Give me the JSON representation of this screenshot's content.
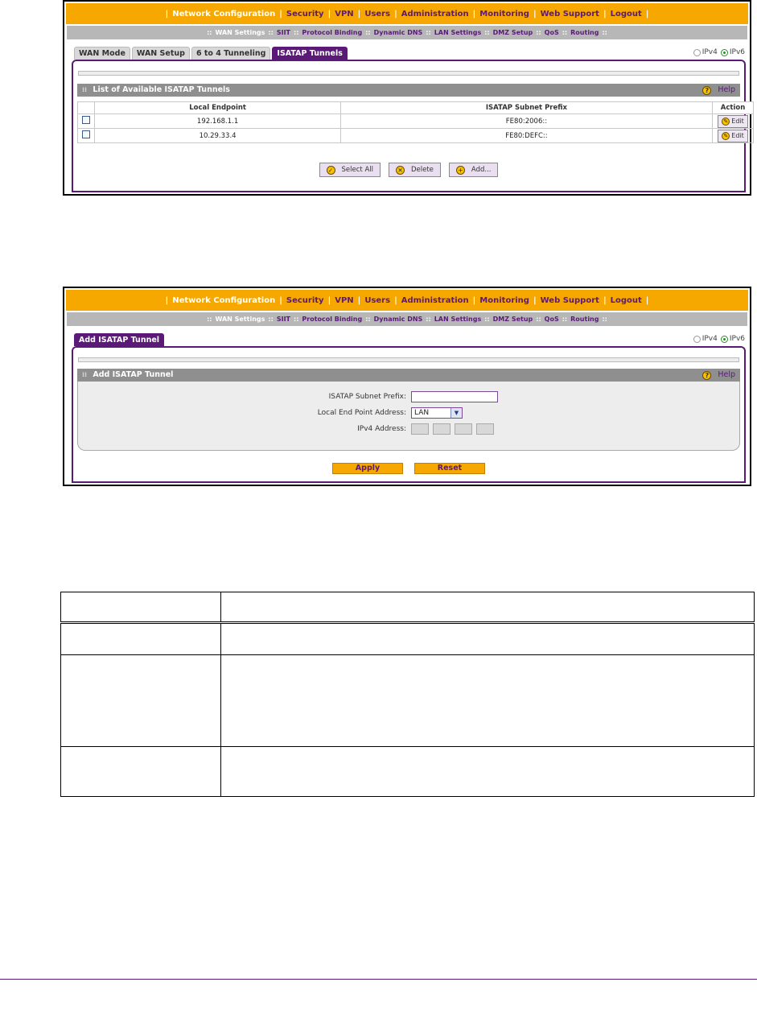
{
  "nav": {
    "top": [
      "Network Configuration",
      "Security",
      "VPN",
      "Users",
      "Administration",
      "Monitoring",
      "Web Support",
      "Logout"
    ],
    "sub": [
      "WAN Settings",
      "SIIT",
      "Protocol Binding",
      "Dynamic DNS",
      "LAN Settings",
      "DMZ Setup",
      "QoS",
      "Routing"
    ]
  },
  "screen1": {
    "tabs": [
      "WAN Mode",
      "WAN Setup",
      "6 to 4 Tunneling",
      "ISATAP Tunnels"
    ],
    "ip_options": [
      "IPv4",
      "IPv6"
    ],
    "section_title": "List of Available ISATAP Tunnels",
    "help_label": "Help",
    "columns": [
      "Local Endpoint",
      "ISATAP Subnet Prefix",
      "Action"
    ],
    "rows": [
      {
        "endpoint": "192.168.1.1",
        "prefix": "FE80:2006::",
        "action": "Edit"
      },
      {
        "endpoint": "10.29.33.4",
        "prefix": "FE80:DEFC::",
        "action": "Edit"
      }
    ],
    "buttons": [
      "Select All",
      "Delete",
      "Add..."
    ]
  },
  "screen2": {
    "tab": "Add ISATAP Tunnel",
    "ip_options": [
      "IPv4",
      "IPv6"
    ],
    "section_title": "Add ISATAP Tunnel",
    "help_label": "Help",
    "fields": {
      "prefix_label": "ISATAP Subnet Prefix:",
      "prefix_value": "",
      "endpoint_label": "Local End Point Address:",
      "endpoint_value": "LAN",
      "ipv4_label": "IPv4 Address:"
    },
    "buttons": [
      "Apply",
      "Reset"
    ]
  },
  "colors": {
    "orange": "#f7a800",
    "purple": "#5b1a78",
    "gray": "#8f8f8f"
  }
}
